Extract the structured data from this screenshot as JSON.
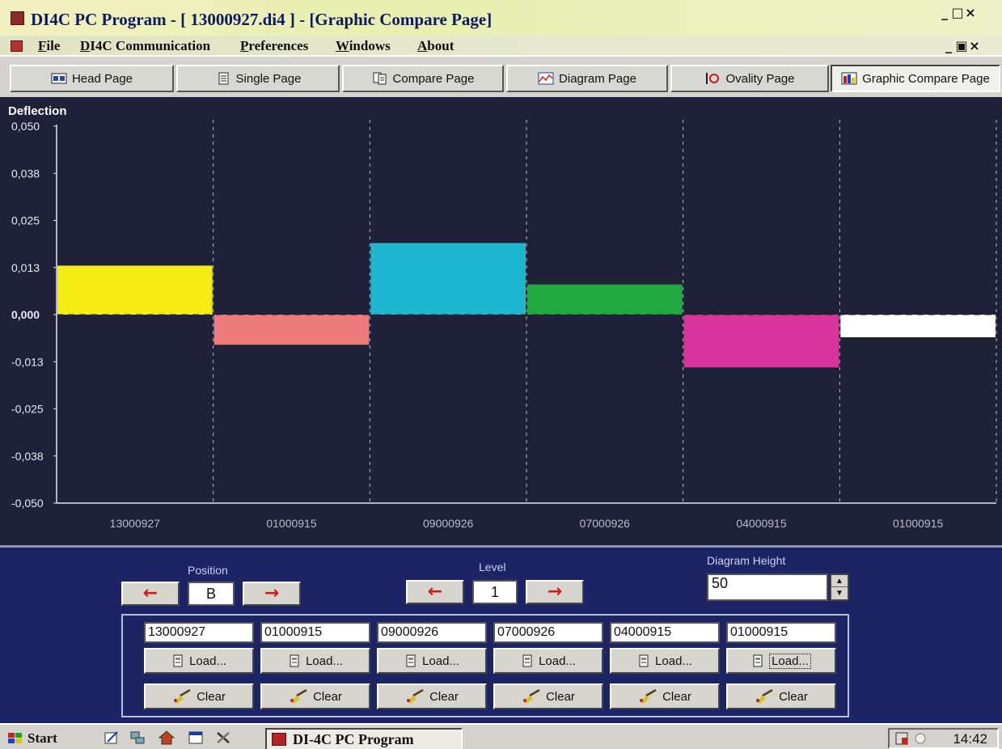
{
  "window": {
    "title": "DI4C PC Program - [ 13000927.di4 ] - [Graphic Compare Page]",
    "controls": {
      "minimize": "_",
      "maximize": "□",
      "close": "×"
    },
    "doc_controls": {
      "minimize": "_",
      "restore": "▣",
      "close": "×"
    }
  },
  "menu": {
    "items": [
      {
        "prefix": "F",
        "rest": "ile"
      },
      {
        "prefix": "D",
        "rest": "I4C Communication"
      },
      {
        "prefix": "P",
        "rest": "references"
      },
      {
        "prefix": "W",
        "rest": "indows"
      },
      {
        "prefix": "A",
        "rest": "bout"
      }
    ]
  },
  "tabs": [
    {
      "label": "Head Page",
      "icon": "head-page-icon",
      "active": false
    },
    {
      "label": "Single Page",
      "icon": "single-page-icon",
      "active": false
    },
    {
      "label": "Compare Page",
      "icon": "compare-page-icon",
      "active": false
    },
    {
      "label": "Diagram Page",
      "icon": "diagram-page-icon",
      "active": false
    },
    {
      "label": "Ovality Page",
      "icon": "ovality-page-icon",
      "active": false
    },
    {
      "label": "Graphic Compare Page",
      "icon": "graphic-compare-page-icon",
      "active": true
    }
  ],
  "chart_data": {
    "type": "bar",
    "ylabel": "Deflection",
    "yticks": [
      "0,050",
      "0,038",
      "0,025",
      "0,013",
      "0,000",
      "-0,013",
      "-0,025",
      "-0,038",
      "-0,050"
    ],
    "ylim": [
      -0.05,
      0.05
    ],
    "grid": "vertical dashed",
    "categories": [
      "13000927",
      "01000915",
      "09000926",
      "07000926",
      "04000915",
      "01000915"
    ],
    "values": [
      0.013,
      -0.008,
      0.019,
      0.008,
      -0.014,
      -0.006
    ],
    "colors": [
      "#f5ec14",
      "#ee7b7b",
      "#1fb6cf",
      "#22a840",
      "#d8349c",
      "#ffffff"
    ]
  },
  "controls": {
    "position": {
      "label": "Position",
      "value": "B",
      "prev": "←",
      "next": "→"
    },
    "level": {
      "label": "Level",
      "value": "1",
      "prev": "←",
      "next": "→"
    },
    "diagram_height": {
      "label": "Diagram Height",
      "value": "50"
    }
  },
  "files": [
    {
      "name": "13000927",
      "load": "Load...",
      "clear": "Clear"
    },
    {
      "name": "01000915",
      "load": "Load...",
      "clear": "Clear"
    },
    {
      "name": "09000926",
      "load": "Load...",
      "clear": "Clear"
    },
    {
      "name": "07000926",
      "load": "Load...",
      "clear": "Clear"
    },
    {
      "name": "04000915",
      "load": "Load...",
      "clear": "Clear"
    },
    {
      "name": "01000915",
      "load": "Load...",
      "clear": "Clear"
    }
  ],
  "taskbar": {
    "start": "Start",
    "app": "DI-4C PC Program",
    "clock": "14:42"
  }
}
